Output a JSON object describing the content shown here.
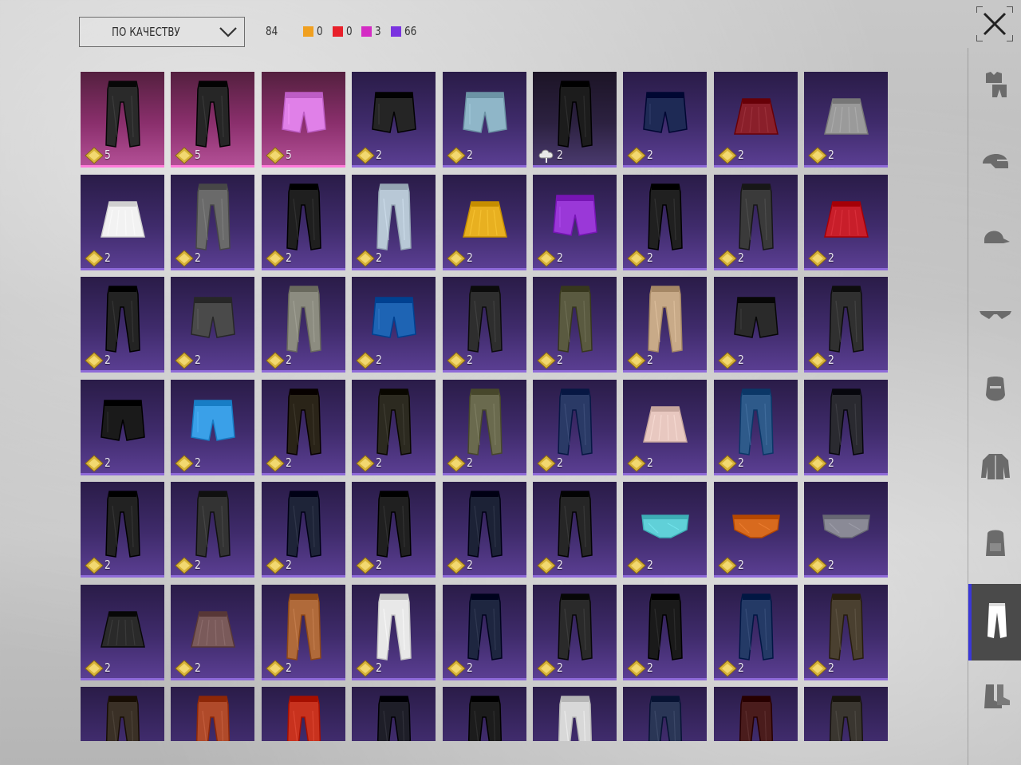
{
  "toolbar": {
    "sort_label": "ПО КАЧЕСТВУ",
    "total_count": "84",
    "rarities": [
      {
        "color": "#f0a020",
        "count": "0"
      },
      {
        "color": "#e8202a",
        "count": "0"
      },
      {
        "color": "#d42cc4",
        "count": "3"
      },
      {
        "color": "#7a34e0",
        "count": "66"
      }
    ]
  },
  "sidebar": {
    "categories": [
      {
        "id": "outfit",
        "icon": "outfit-icon",
        "active": false
      },
      {
        "id": "helmet",
        "icon": "helmet-icon",
        "active": false
      },
      {
        "id": "cap",
        "icon": "cap-icon",
        "active": false
      },
      {
        "id": "glasses",
        "icon": "glasses-icon",
        "active": false
      },
      {
        "id": "mask",
        "icon": "mask-icon",
        "active": false
      },
      {
        "id": "jacket",
        "icon": "jacket-icon",
        "active": false
      },
      {
        "id": "backpack",
        "icon": "backpack-icon",
        "active": false
      },
      {
        "id": "pants",
        "icon": "pants-icon",
        "active": true
      },
      {
        "id": "shoes",
        "icon": "shoes-icon",
        "active": false
      }
    ]
  },
  "items": [
    {
      "qty": "5",
      "rarity": "pink",
      "kind": "pants",
      "color": "#2a2a2a"
    },
    {
      "qty": "5",
      "rarity": "pink",
      "kind": "pants",
      "color": "#262626"
    },
    {
      "qty": "5",
      "rarity": "pink",
      "kind": "shorts",
      "color": "#e080e8"
    },
    {
      "qty": "2",
      "rarity": "purple",
      "kind": "shorts",
      "color": "#252525"
    },
    {
      "qty": "2",
      "rarity": "purple",
      "kind": "shorts",
      "color": "#8fb6c8"
    },
    {
      "qty": "2",
      "rarity": "dark",
      "kind": "pants",
      "color": "#1c1c1c",
      "cloud": true
    },
    {
      "qty": "2",
      "rarity": "purple",
      "kind": "shorts",
      "color": "#1e2a55"
    },
    {
      "qty": "2",
      "rarity": "purple",
      "kind": "skirt",
      "color": "#8a1f2a"
    },
    {
      "qty": "2",
      "rarity": "purple",
      "kind": "skirt",
      "color": "#9a9a9a"
    },
    {
      "qty": "2",
      "rarity": "purple",
      "kind": "skirt",
      "color": "#f2f2f2"
    },
    {
      "qty": "2",
      "rarity": "purple",
      "kind": "pants",
      "color": "#6a6a6a"
    },
    {
      "qty": "2",
      "rarity": "purple",
      "kind": "pants",
      "color": "#1f1f1f"
    },
    {
      "qty": "2",
      "rarity": "purple",
      "kind": "pants",
      "color": "#b8c8d6"
    },
    {
      "qty": "2",
      "rarity": "purple",
      "kind": "skirt",
      "color": "#e8b020"
    },
    {
      "qty": "2",
      "rarity": "purple",
      "kind": "shorts",
      "color": "#9a38d8"
    },
    {
      "qty": "2",
      "rarity": "purple",
      "kind": "pants",
      "color": "#202020"
    },
    {
      "qty": "2",
      "rarity": "purple",
      "kind": "pants",
      "color": "#3a3a3a"
    },
    {
      "qty": "2",
      "rarity": "purple",
      "kind": "skirt",
      "color": "#c81e2a"
    },
    {
      "qty": "2",
      "rarity": "purple",
      "kind": "pants",
      "color": "#232323"
    },
    {
      "qty": "2",
      "rarity": "purple",
      "kind": "shorts",
      "color": "#4a4a4a"
    },
    {
      "qty": "2",
      "rarity": "purple",
      "kind": "pants",
      "color": "#8c8c80"
    },
    {
      "qty": "2",
      "rarity": "purple",
      "kind": "shorts",
      "color": "#1e64b4"
    },
    {
      "qty": "2",
      "rarity": "purple",
      "kind": "pants",
      "color": "#2e2e2e"
    },
    {
      "qty": "2",
      "rarity": "purple",
      "kind": "pants",
      "color": "#5a5a40"
    },
    {
      "qty": "2",
      "rarity": "purple",
      "kind": "pants",
      "color": "#c8aa88"
    },
    {
      "qty": "2",
      "rarity": "purple",
      "kind": "shorts",
      "color": "#2a2a2a"
    },
    {
      "qty": "2",
      "rarity": "purple",
      "kind": "pants",
      "color": "#303030"
    },
    {
      "qty": "2",
      "rarity": "purple",
      "kind": "shorts",
      "color": "#1a1a1a"
    },
    {
      "qty": "2",
      "rarity": "purple",
      "kind": "shorts",
      "color": "#3aa0e8"
    },
    {
      "qty": "2",
      "rarity": "purple",
      "kind": "pants",
      "color": "#2a2418"
    },
    {
      "qty": "2",
      "rarity": "purple",
      "kind": "pants",
      "color": "#2c2a20"
    },
    {
      "qty": "2",
      "rarity": "purple",
      "kind": "pants",
      "color": "#6a6a4e"
    },
    {
      "qty": "2",
      "rarity": "purple",
      "kind": "pants",
      "color": "#2a3a66"
    },
    {
      "qty": "2",
      "rarity": "purple",
      "kind": "skirt",
      "color": "#e8c8c0"
    },
    {
      "qty": "2",
      "rarity": "purple",
      "kind": "pants",
      "color": "#2e5a8a"
    },
    {
      "qty": "2",
      "rarity": "purple",
      "kind": "pants",
      "color": "#2a2a30"
    },
    {
      "qty": "2",
      "rarity": "purple",
      "kind": "pants",
      "color": "#222222"
    },
    {
      "qty": "2",
      "rarity": "purple",
      "kind": "pants",
      "color": "#333333"
    },
    {
      "qty": "2",
      "rarity": "purple",
      "kind": "pants",
      "color": "#1e2438"
    },
    {
      "qty": "2",
      "rarity": "purple",
      "kind": "pants",
      "color": "#202020"
    },
    {
      "qty": "2",
      "rarity": "purple",
      "kind": "pants",
      "color": "#1c2236"
    },
    {
      "qty": "2",
      "rarity": "purple",
      "kind": "pants",
      "color": "#262626"
    },
    {
      "qty": "2",
      "rarity": "purple",
      "kind": "briefs",
      "color": "#60d0d8"
    },
    {
      "qty": "2",
      "rarity": "purple",
      "kind": "briefs",
      "color": "#d86a1e"
    },
    {
      "qty": "2",
      "rarity": "purple",
      "kind": "briefs",
      "color": "#8a8a96"
    },
    {
      "qty": "2",
      "rarity": "purple",
      "kind": "skirt",
      "color": "#2a2a2a"
    },
    {
      "qty": "2",
      "rarity": "purple",
      "kind": "skirt",
      "color": "#7a5a5a"
    },
    {
      "qty": "2",
      "rarity": "purple",
      "kind": "pants",
      "color": "#b06a3a"
    },
    {
      "qty": "2",
      "rarity": "purple",
      "kind": "pants",
      "color": "#e8e8e8"
    },
    {
      "qty": "2",
      "rarity": "purple",
      "kind": "pants",
      "color": "#1e2640"
    },
    {
      "qty": "2",
      "rarity": "purple",
      "kind": "pants",
      "color": "#2a2a2a"
    },
    {
      "qty": "2",
      "rarity": "purple",
      "kind": "pants",
      "color": "#1a1a1a"
    },
    {
      "qty": "2",
      "rarity": "purple",
      "kind": "pants",
      "color": "#243a66"
    },
    {
      "qty": "2",
      "rarity": "purple",
      "kind": "pants",
      "color": "#4a4030"
    },
    {
      "qty": "",
      "rarity": "purple",
      "kind": "pants",
      "color": "#3a3026"
    },
    {
      "qty": "",
      "rarity": "purple",
      "kind": "pants",
      "color": "#b04a2a"
    },
    {
      "qty": "",
      "rarity": "purple",
      "kind": "pants",
      "color": "#c8321e"
    },
    {
      "qty": "",
      "rarity": "purple",
      "kind": "pants",
      "color": "#1e1e28"
    },
    {
      "qty": "",
      "rarity": "purple",
      "kind": "pants",
      "color": "#1c1c1c"
    },
    {
      "qty": "",
      "rarity": "purple",
      "kind": "pants",
      "color": "#d8d8d8"
    },
    {
      "qty": "",
      "rarity": "purple",
      "kind": "pants",
      "color": "#2a3656"
    },
    {
      "qty": "",
      "rarity": "purple",
      "kind": "pants",
      "color": "#4a1c1c"
    },
    {
      "qty": "",
      "rarity": "purple",
      "kind": "pants",
      "color": "#3a3630"
    }
  ]
}
